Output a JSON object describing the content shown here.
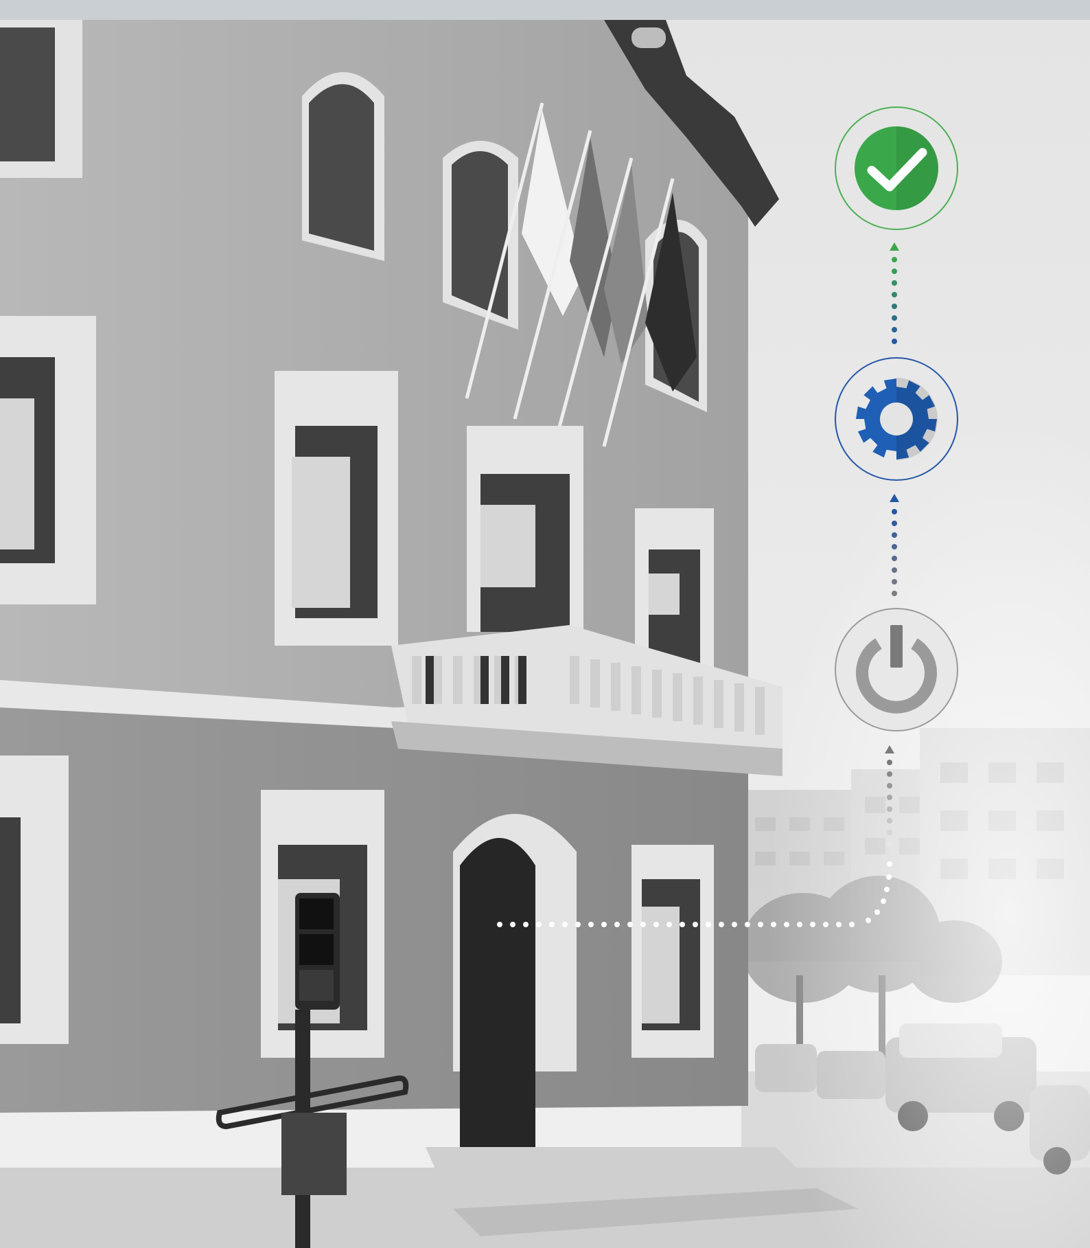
{
  "scene": {
    "description_free": true,
    "top_bar_color": "#c9cfd2",
    "sky_color": "#e9e9e9",
    "facade_upper_color": "#a9a9a9",
    "facade_lower_color": "#8c8c8c",
    "trim_color": "#e6e6e6"
  },
  "process_flow": {
    "steps": [
      {
        "icon": "check-icon",
        "state": "complete",
        "color": "#3aa84a",
        "ring_color": "#4caf50"
      },
      {
        "icon": "gear-icon",
        "state": "processing",
        "color": "#1f5fb5",
        "ring_color": "#2456a6"
      },
      {
        "icon": "power-icon",
        "state": "start",
        "color": "#9a9a9a",
        "ring_color": "#9a9a9a"
      }
    ],
    "connector_colors": [
      "#3aa84a",
      "#2456a6",
      "#7a7a7a",
      "#ffffff"
    ]
  }
}
